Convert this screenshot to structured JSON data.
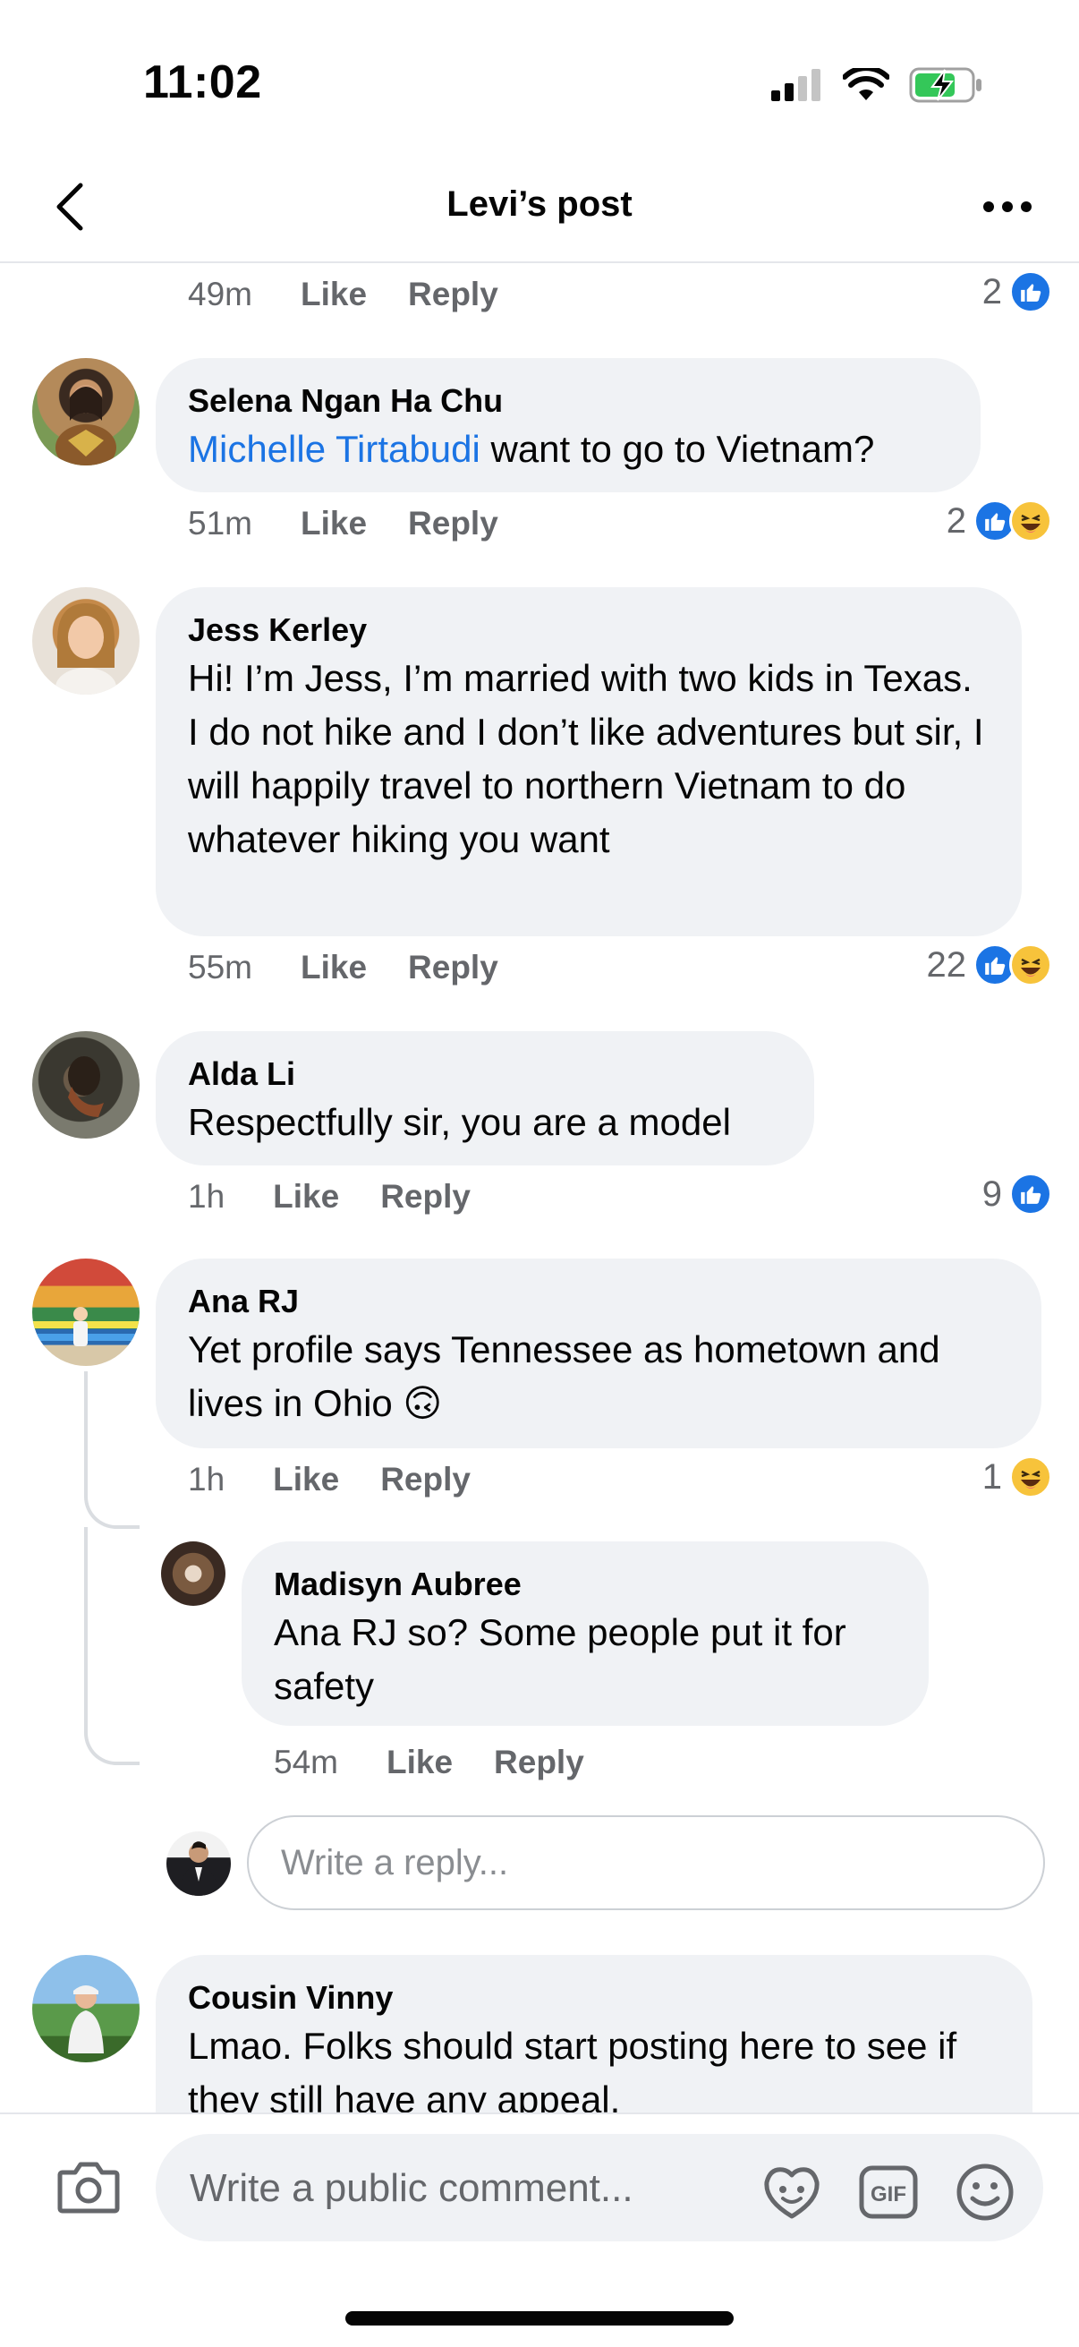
{
  "status_bar": {
    "time": "11:02",
    "icons": [
      "signal-icon",
      "wifi-icon",
      "battery-charging-icon"
    ]
  },
  "header": {
    "title": "Levi’s post",
    "back_icon": "chevron-left-icon",
    "more_icon": "more-horizontal-icon"
  },
  "actions": {
    "like": "Like",
    "reply": "Reply"
  },
  "top_meta": {
    "time": "49m",
    "reaction_count": "2",
    "reactions": [
      "like"
    ]
  },
  "comments": [
    {
      "author": "Selena Ngan Ha Chu",
      "mention": "Michelle Tirtabudi",
      "text": " want to go to Vietnam?",
      "time": "51m",
      "reaction_count": "2",
      "reactions": [
        "like",
        "haha"
      ]
    },
    {
      "author": "Jess Kerley",
      "text": "Hi! I’m Jess, I’m married with two kids in Texas. I do not hike and I don’t like adventures but sir, I will happily travel to northern Vietnam to do whatever hiking you want",
      "time": "55m",
      "reaction_count": "22",
      "reactions": [
        "like",
        "haha"
      ]
    },
    {
      "author": "Alda Li",
      "text": "Respectfully sir, you are a model",
      "time": "1h",
      "reaction_count": "9",
      "reactions": [
        "like"
      ]
    },
    {
      "author": "Ana RJ",
      "text": "Yet profile says Tennessee as hometown and lives in Ohio 🙃",
      "time": "1h",
      "reaction_count": "1",
      "reactions": [
        "haha"
      ],
      "replies": [
        {
          "author": "Madisyn Aubree",
          "text": "Ana RJ so? Some people put it for safety",
          "time": "54m"
        }
      ]
    },
    {
      "author": "Cousin Vinny",
      "text": "Lmao. Folks should start posting here to see if they still have any appeal."
    }
  ],
  "reply_input": {
    "placeholder": "Write a reply..."
  },
  "composer": {
    "placeholder": "Write a public comment...",
    "icons": [
      "camera-icon",
      "avatar-sticker-icon",
      "gif-icon",
      "emoji-icon"
    ],
    "gif_label": "GIF"
  },
  "colors": {
    "accent": "#1b74e4",
    "bubble": "#f0f2f5",
    "meta_text": "#65676b",
    "haha": "#f7c33b"
  }
}
